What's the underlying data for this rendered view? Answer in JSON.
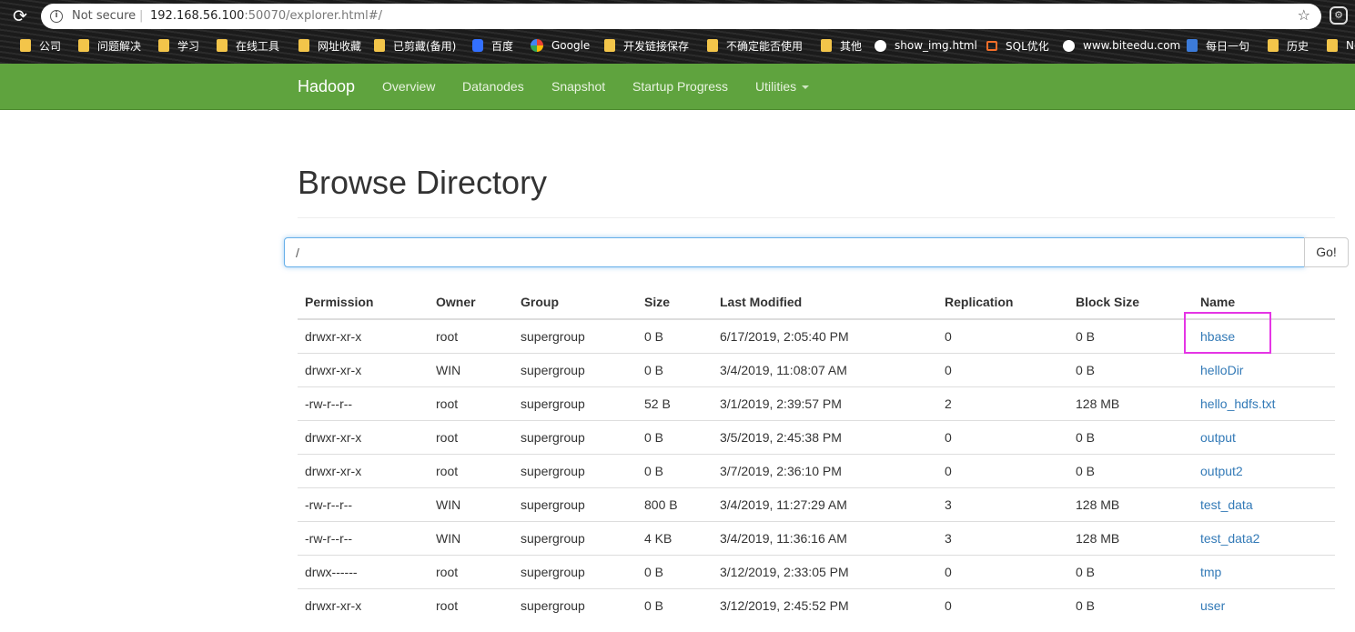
{
  "browser": {
    "security_label": "Not secure",
    "url_host": "192.168.56.100",
    "url_rest": ":50070/explorer.html#/",
    "bookmarks": [
      {
        "label": "公司",
        "icon": "folder-icon"
      },
      {
        "label": "问题解决",
        "icon": "folder-icon"
      },
      {
        "label": "学习",
        "icon": "folder-icon"
      },
      {
        "label": "在线工具",
        "icon": "folder-icon"
      },
      {
        "label": "网址收藏",
        "icon": "folder-icon"
      },
      {
        "label": "已剪藏(备用)",
        "icon": "folder-icon"
      },
      {
        "label": "百度",
        "icon": "baidu-icon"
      },
      {
        "label": "Google",
        "icon": "google-icon"
      },
      {
        "label": "开发链接保存",
        "icon": "folder-icon"
      },
      {
        "label": "不确定能否使用",
        "icon": "folder-icon"
      },
      {
        "label": "其他",
        "icon": "folder-icon"
      },
      {
        "label": "show_img.html",
        "icon": "globe-icon"
      },
      {
        "label": "SQL优化",
        "icon": "sql-icon"
      },
      {
        "label": "www.biteedu.com",
        "icon": "globe-icon"
      },
      {
        "label": "每日一句",
        "icon": "meiri-icon"
      },
      {
        "label": "历史",
        "icon": "folder-icon"
      },
      {
        "label": "Ne",
        "icon": "folder-icon"
      }
    ]
  },
  "navbar": {
    "brand": "Hadoop",
    "items": [
      "Overview",
      "Datanodes",
      "Snapshot",
      "Startup Progress",
      "Utilities"
    ]
  },
  "page": {
    "title": "Browse Directory",
    "path_value": "/",
    "go_label": "Go!"
  },
  "table": {
    "headers": [
      "Permission",
      "Owner",
      "Group",
      "Size",
      "Last Modified",
      "Replication",
      "Block Size",
      "Name"
    ],
    "rows": [
      [
        "drwxr-xr-x",
        "root",
        "supergroup",
        "0 B",
        "6/17/2019, 2:05:40 PM",
        "0",
        "0 B",
        "hbase"
      ],
      [
        "drwxr-xr-x",
        "WIN",
        "supergroup",
        "0 B",
        "3/4/2019, 11:08:07 AM",
        "0",
        "0 B",
        "helloDir"
      ],
      [
        "-rw-r--r--",
        "root",
        "supergroup",
        "52 B",
        "3/1/2019, 2:39:57 PM",
        "2",
        "128 MB",
        "hello_hdfs.txt"
      ],
      [
        "drwxr-xr-x",
        "root",
        "supergroup",
        "0 B",
        "3/5/2019, 2:45:38 PM",
        "0",
        "0 B",
        "output"
      ],
      [
        "drwxr-xr-x",
        "root",
        "supergroup",
        "0 B",
        "3/7/2019, 2:36:10 PM",
        "0",
        "0 B",
        "output2"
      ],
      [
        "-rw-r--r--",
        "WIN",
        "supergroup",
        "800 B",
        "3/4/2019, 11:27:29 AM",
        "3",
        "128 MB",
        "test_data"
      ],
      [
        "-rw-r--r--",
        "WIN",
        "supergroup",
        "4 KB",
        "3/4/2019, 11:36:16 AM",
        "3",
        "128 MB",
        "test_data2"
      ],
      [
        "drwx------",
        "root",
        "supergroup",
        "0 B",
        "3/12/2019, 2:33:05 PM",
        "0",
        "0 B",
        "tmp"
      ],
      [
        "drwxr-xr-x",
        "root",
        "supergroup",
        "0 B",
        "3/12/2019, 2:45:52 PM",
        "0",
        "0 B",
        "user"
      ]
    ]
  },
  "colors": {
    "navbar_bg": "#5fa33e",
    "link": "#337ab7",
    "highlight_box": "#e535e5"
  }
}
